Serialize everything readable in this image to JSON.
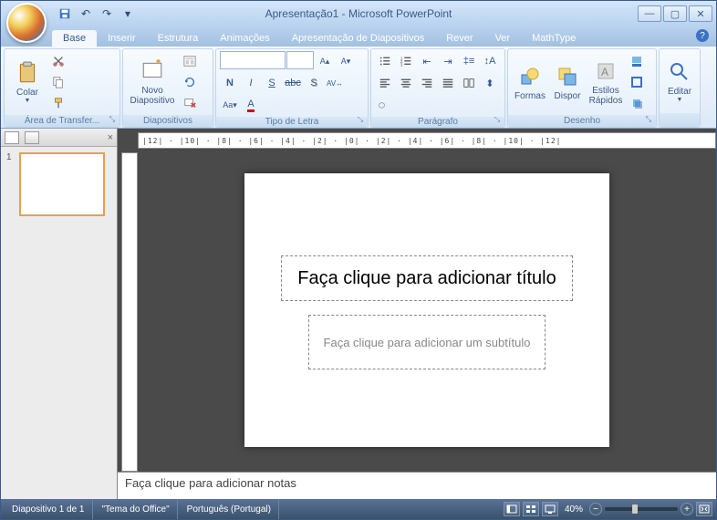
{
  "title": "Apresentação1 - Microsoft PowerPoint",
  "tabs": {
    "base": "Base",
    "inserir": "Inserir",
    "estrutura": "Estrutura",
    "animacoes": "Animações",
    "apresentacao": "Apresentação de Diapositivos",
    "rever": "Rever",
    "ver": "Ver",
    "mathtype": "MathType"
  },
  "ribbon": {
    "clipboard": {
      "label": "Área de Transfer...",
      "colar": "Colar"
    },
    "slides": {
      "label": "Diapositivos",
      "novo": "Novo\nDiapositivo"
    },
    "font": {
      "label": "Tipo de Letra",
      "name_ph": "",
      "size_ph": ""
    },
    "paragraph": {
      "label": "Parágrafo"
    },
    "drawing": {
      "label": "Desenho",
      "formas": "Formas",
      "dispor": "Dispor",
      "estilos": "Estilos\nRápidos"
    },
    "editing": {
      "label": "",
      "editar": "Editar"
    }
  },
  "ruler": "|12| · |10| · |8| · |6| · |4| · |2| · |0| · |2| · |4| · |6| · |8| · |10| · |12|",
  "thumbs": {
    "n1": "1"
  },
  "slide": {
    "title_ph": "Faça clique para adicionar título",
    "subtitle_ph": "Faça clique para adicionar um subtítulo"
  },
  "notes_ph": "Faça clique para adicionar notas",
  "status": {
    "slide": "Diapositivo 1 de 1",
    "theme": "\"Tema do Office\"",
    "lang": "Português (Portugal)",
    "zoom": "40%"
  }
}
